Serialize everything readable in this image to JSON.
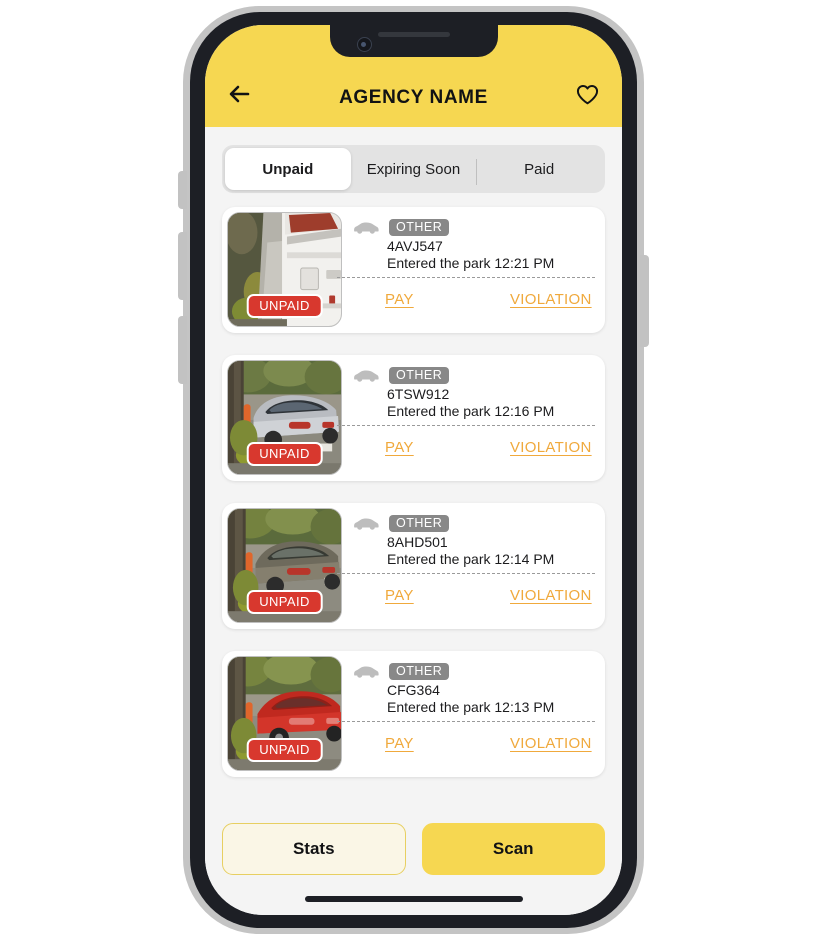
{
  "header": {
    "back_icon": "arrow-left-icon",
    "title": "AGENCY NAME",
    "favorite_icon": "heart-icon",
    "background_color": "#F6D751"
  },
  "tabs": {
    "items": [
      {
        "label": "Unpaid",
        "active": true
      },
      {
        "label": "Expiring Soon",
        "active": false
      },
      {
        "label": "Paid",
        "active": false
      }
    ]
  },
  "list": {
    "cards": [
      {
        "vehicle_icon": "car-icon",
        "type_badge": "OTHER",
        "plate": "4AVJ547",
        "entered": "Entered the park 12:21 PM",
        "status_badge": "UNPAID",
        "pay_label": "PAY",
        "violation_label": "VIOLATION",
        "photo": "white-rv-beside-driveway"
      },
      {
        "vehicle_icon": "car-icon",
        "type_badge": "OTHER",
        "plate": "6TSW912",
        "entered": "Entered the park 12:16 PM",
        "status_badge": "UNPAID",
        "pay_label": "PAY",
        "violation_label": "VIOLATION",
        "photo": "silver-sedan-on-park-road"
      },
      {
        "vehicle_icon": "car-icon",
        "type_badge": "OTHER",
        "plate": "8AHD501",
        "entered": "Entered the park 12:14 PM",
        "status_badge": "UNPAID",
        "pay_label": "PAY",
        "violation_label": "VIOLATION",
        "photo": "dark-tan-sedan-on-park-road"
      },
      {
        "vehicle_icon": "car-icon",
        "type_badge": "OTHER",
        "plate": "CFG364",
        "entered": "Entered the park 12:13 PM",
        "status_badge": "UNPAID",
        "pay_label": "PAY",
        "violation_label": "VIOLATION",
        "photo": "red-coupe-on-park-road"
      }
    ]
  },
  "bottom_bar": {
    "stats_label": "Stats",
    "scan_label": "Scan"
  },
  "colors": {
    "brand_yellow": "#F6D751",
    "link_orange": "#F0A93C",
    "unpaid_red": "#D8382E",
    "badge_gray": "#888888",
    "page_bg": "#F4F4F4"
  }
}
